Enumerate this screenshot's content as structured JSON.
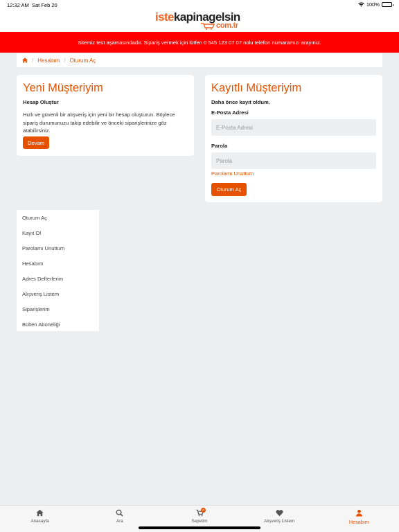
{
  "status_bar": {
    "time": "12:32 AM",
    "date": "Sat Feb 20",
    "battery": "100%"
  },
  "logo": {
    "part1": "iste",
    "part2": "kapinagelsin",
    "part3": "com.tr"
  },
  "banner": {
    "text": "Sitemiz test aşamasındadır. Sipariş vermek için lütfen 0 545 123 07 07 nolu telefon numaramızı arayınız."
  },
  "breadcrumb": {
    "items": [
      "Hesabım",
      "Oturum Aç"
    ]
  },
  "new_customer": {
    "title": "Yeni Müşteriyim",
    "subtitle": "Hesap Oluştur",
    "text": "Hızlı ve güvenli bir alışveriş için yeni bir hesap oluşturun. Böylece sipariş durumunuzu takip edebilir ve önceki siparişlerinize göz atabilirsiniz.",
    "button": "Devam"
  },
  "returning_customer": {
    "title": "Kayıtlı Müşteriyim",
    "subtitle": "Daha önce kayıt oldum.",
    "email_label": "E-Posta Adresi",
    "email_placeholder": "E-Posta Adresi",
    "password_label": "Parola",
    "password_placeholder": "Parola",
    "forgot": "Parolamı Unuttum",
    "button": "Oturum Aç"
  },
  "sidebar": {
    "items": [
      "Oturum Aç",
      "Kayıt Ol",
      "Parolamı Unuttum",
      "Hesabım",
      "Adres Defterlerim",
      "Alışveriş Listem",
      "Siparişlerim",
      "Bülten Aboneliği"
    ]
  },
  "tabbar": {
    "tabs": [
      {
        "label": "Anasayfa",
        "icon": "home-icon"
      },
      {
        "label": "Ara",
        "icon": "search-icon"
      },
      {
        "label": "Sepetim",
        "icon": "cart-icon",
        "badge": "0"
      },
      {
        "label": "Alışveriş Listem",
        "icon": "heart-icon"
      },
      {
        "label": "Hesabım",
        "icon": "user-icon",
        "active": true
      }
    ]
  },
  "colors": {
    "accent": "#e65100",
    "banner": "#ff0000",
    "background": "#eceff1"
  }
}
